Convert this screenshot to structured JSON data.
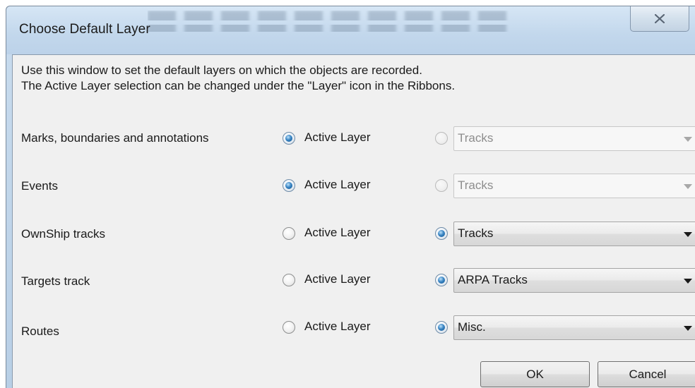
{
  "window": {
    "title": "Choose Default Layer"
  },
  "description": {
    "line1": "Use this window to set the default layers on which the objects are recorded.",
    "line2": "The Active Layer selection can be changed under the \"Layer\" icon in the Ribbons."
  },
  "option_label": "Active Layer",
  "rows": [
    {
      "label": "Marks, boundaries and annotations",
      "active_layer_selected": true,
      "layer": "Tracks",
      "combo_enabled": false
    },
    {
      "label": "Events",
      "active_layer_selected": true,
      "layer": "Tracks",
      "combo_enabled": false
    },
    {
      "label": "OwnShip tracks",
      "active_layer_selected": false,
      "layer": "Tracks",
      "combo_enabled": true
    },
    {
      "label": "Targets track",
      "active_layer_selected": false,
      "layer": "ARPA Tracks",
      "combo_enabled": true
    },
    {
      "label": "Routes",
      "active_layer_selected": false,
      "layer": "Misc.",
      "combo_enabled": true
    }
  ],
  "buttons": {
    "ok": "OK",
    "cancel": "Cancel"
  },
  "icons": {
    "close": "close-icon",
    "dropdown": "chevron-down-icon"
  }
}
